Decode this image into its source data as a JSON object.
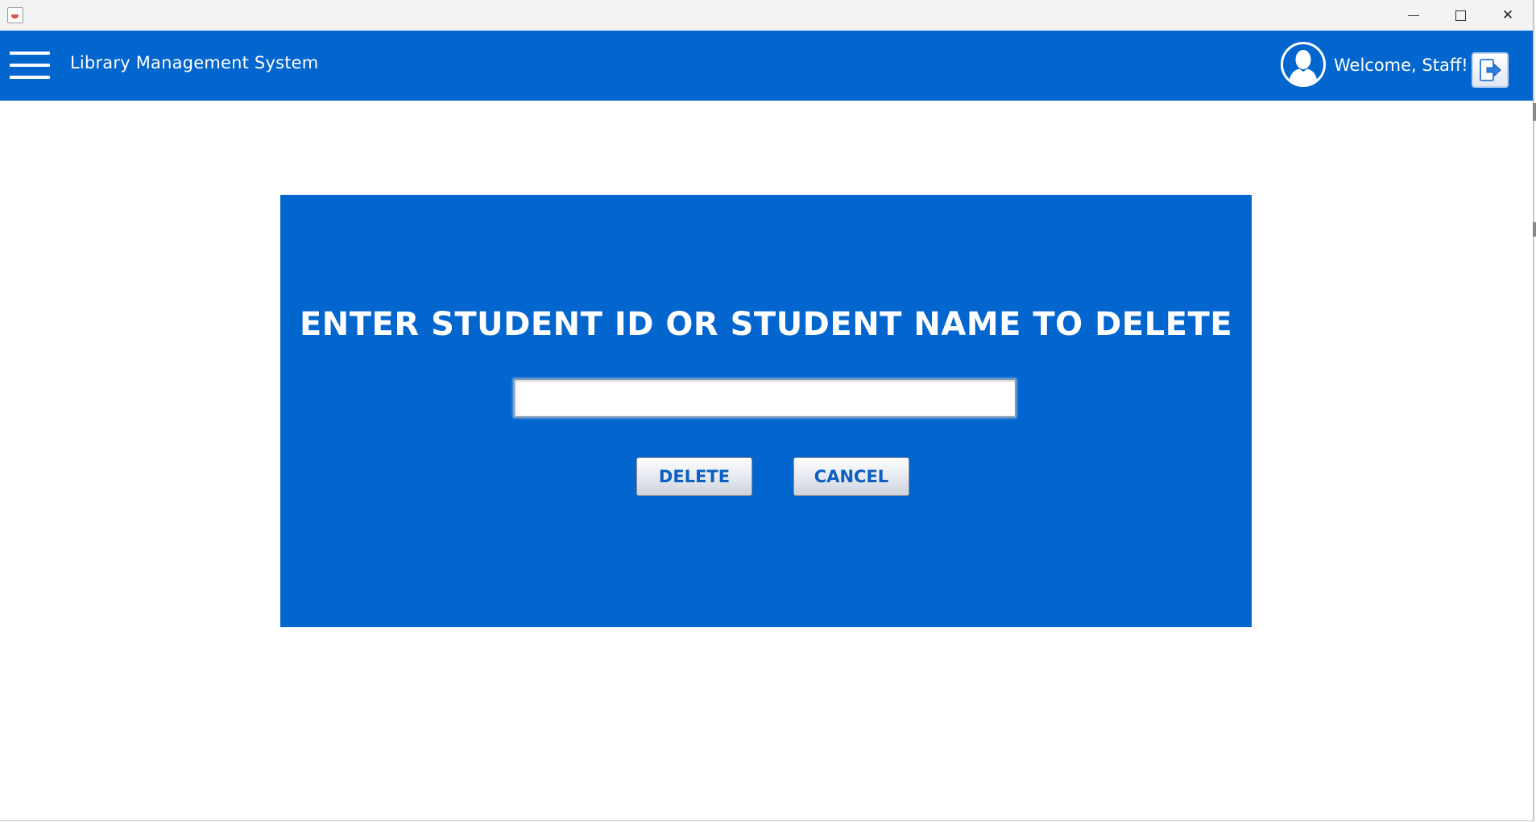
{
  "window": {
    "minimize_icon": "minimize-icon",
    "maximize_icon": "maximize-icon",
    "close_icon": "close-icon",
    "close_glyph": "✕"
  },
  "header": {
    "menu_icon": "hamburger-menu-icon",
    "title": "Library Management System",
    "avatar_icon": "user-avatar-icon",
    "welcome_text": "Welcome, Staff!",
    "logout_icon": "logout-icon",
    "background_color": "#0366ce"
  },
  "delete_panel": {
    "heading": "ENTER STUDENT ID OR STUDENT NAME TO DELETE",
    "input_value": "",
    "input_placeholder": "",
    "delete_label": "DELETE",
    "cancel_label": "CANCEL",
    "background_color": "#0366ce",
    "button_text_color": "#0b5fc0"
  }
}
